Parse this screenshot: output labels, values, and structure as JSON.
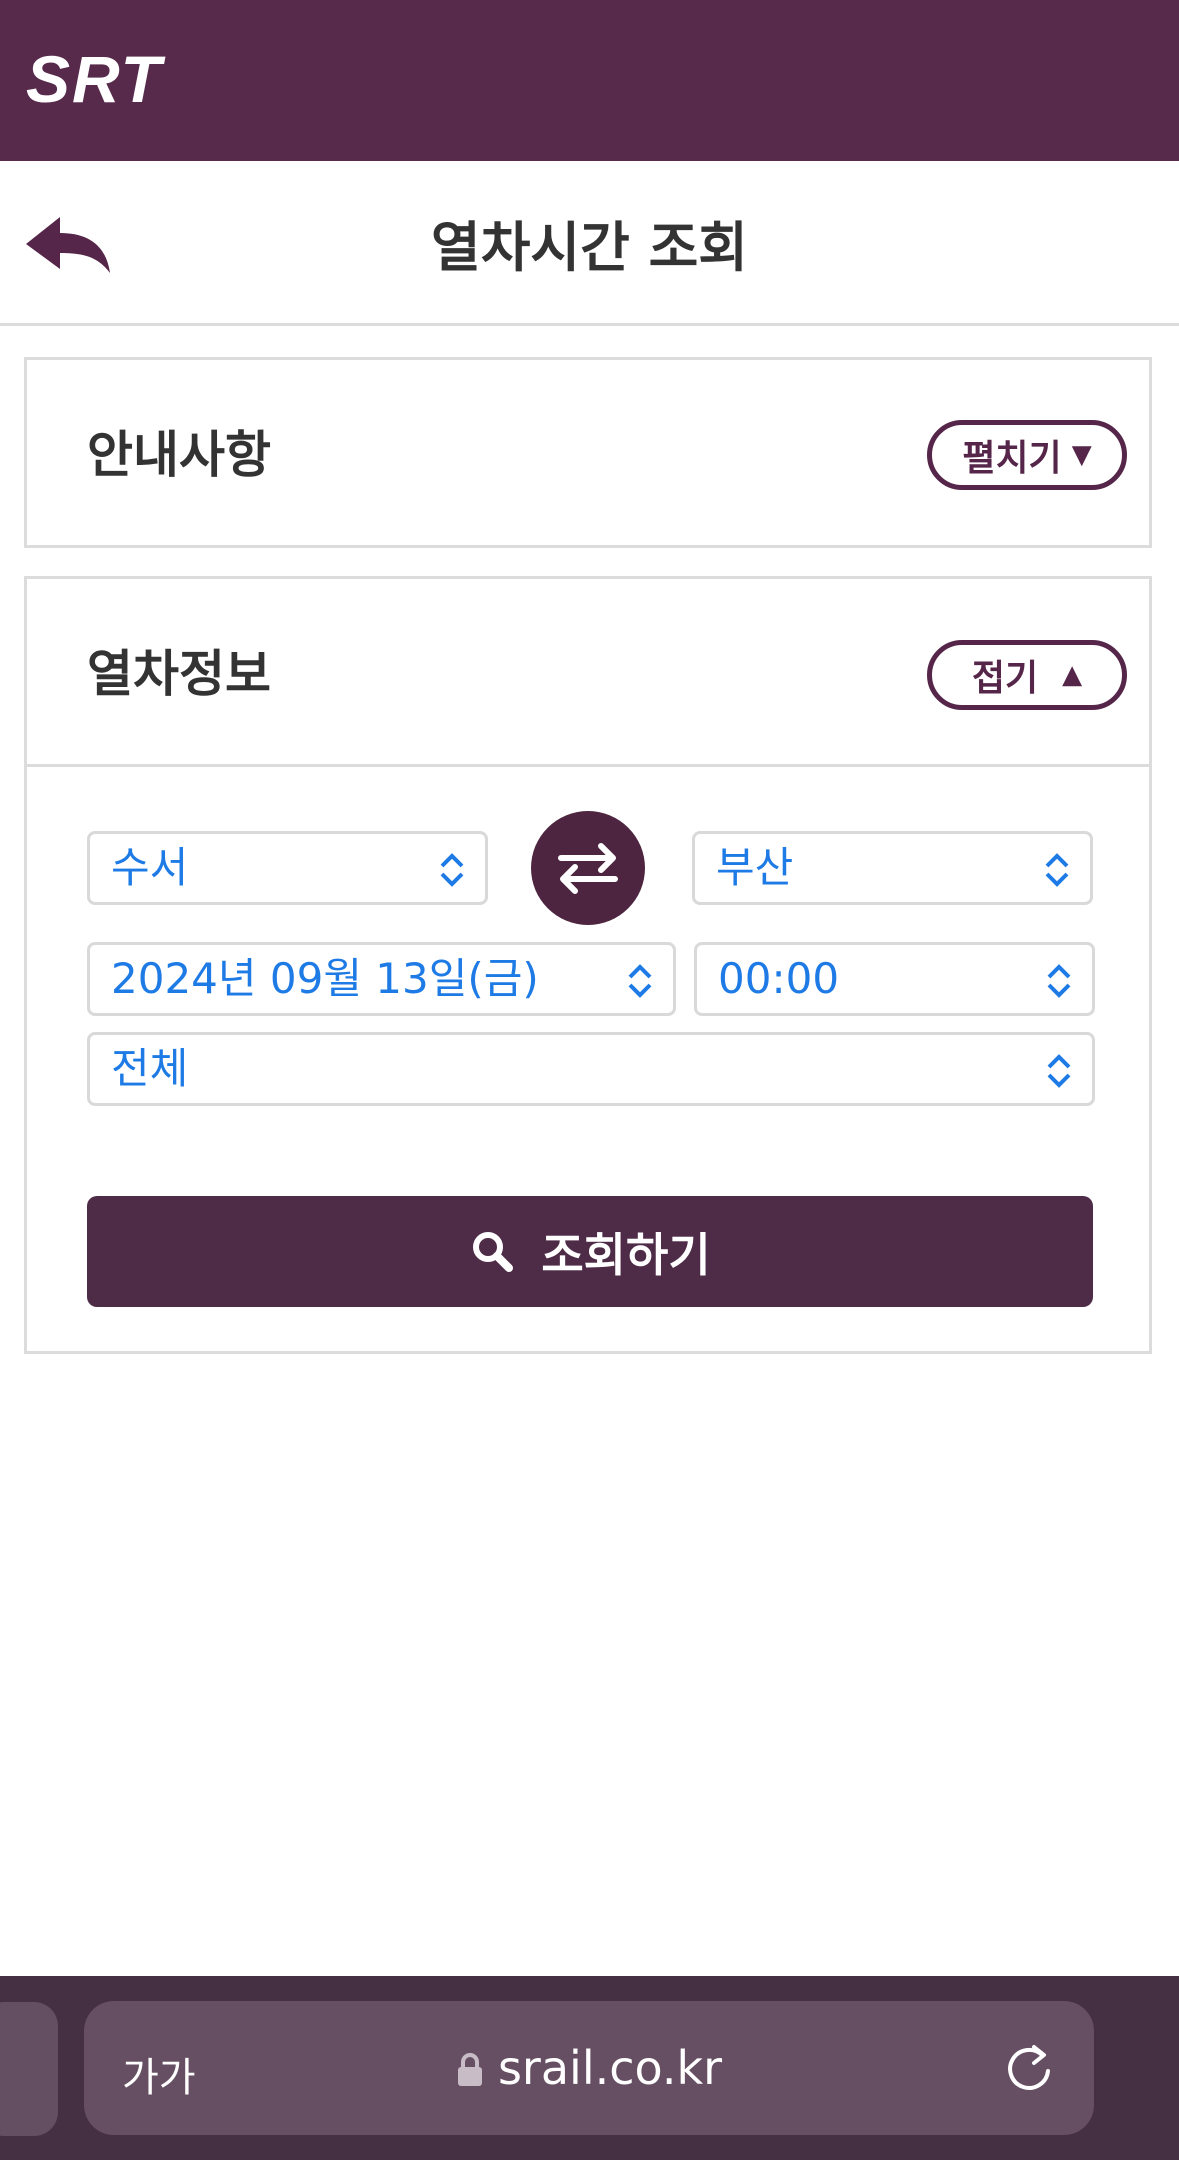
{
  "header": {
    "logo_text": "SRT",
    "brand_color": "#572a4c"
  },
  "titlebar": {
    "title": "열차시간 조회",
    "back_icon": "back-arrow-icon"
  },
  "notice_panel": {
    "title": "안내사항",
    "toggle_label": "펼치기",
    "toggle_icon": "triangle-down-icon"
  },
  "train_panel": {
    "title": "열차정보",
    "toggle_label": "접기",
    "toggle_icon": "triangle-up-icon",
    "departure": "수서",
    "arrival": "부산",
    "swap_icon": "swap-arrows-icon",
    "date": "2024년 09월 13일(금)",
    "time": "00:00",
    "train_type": "전체",
    "search_label": "조회하기",
    "search_icon": "search-icon",
    "accent_color": "#1e7be6"
  },
  "browser": {
    "text_size_label": "가가",
    "url": "srail.co.kr",
    "lock_icon": "lock-icon",
    "reload_icon": "reload-icon"
  }
}
